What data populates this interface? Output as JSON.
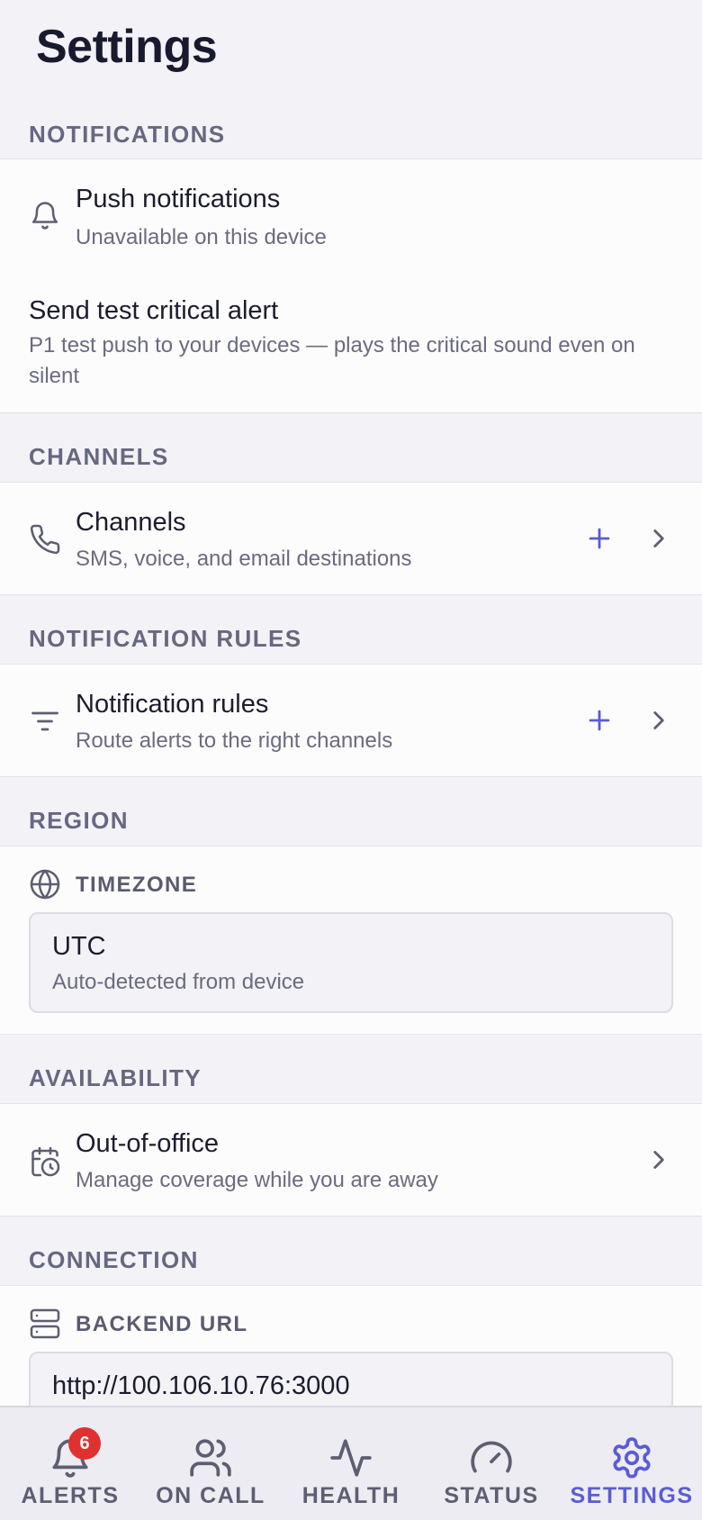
{
  "header": {
    "title": "Settings"
  },
  "sections": {
    "notifications": {
      "label": "NOTIFICATIONS",
      "push": {
        "title": "Push notifications",
        "subtitle": "Unavailable on this device",
        "icon": "bell-icon"
      },
      "test_alert": {
        "title": "Send test critical alert",
        "subtitle": "P1 test push to your devices — plays the critical sound even on silent"
      }
    },
    "channels": {
      "label": "CHANNELS",
      "row": {
        "title": "Channels",
        "subtitle": "SMS, voice, and email destinations",
        "icon": "phone-icon"
      }
    },
    "rules": {
      "label": "NOTIFICATION RULES",
      "row": {
        "title": "Notification rules",
        "subtitle": "Route alerts to the right channels",
        "icon": "filter-icon"
      }
    },
    "region": {
      "label": "REGION",
      "timezone_label": "TIMEZONE",
      "timezone_value": "UTC",
      "timezone_hint": "Auto-detected from device"
    },
    "availability": {
      "label": "AVAILABILITY",
      "row": {
        "title": "Out-of-office",
        "subtitle": "Manage coverage while you are away",
        "icon": "calendar-clock-icon"
      }
    },
    "connection": {
      "label": "CONNECTION",
      "backend_label": "BACKEND URL",
      "backend_value": "http://100.106.10.76:3000"
    }
  },
  "tabbar": {
    "tabs": [
      {
        "label": "ALERTS",
        "icon": "bell-icon",
        "badge": "6"
      },
      {
        "label": "ON CALL",
        "icon": "users-icon"
      },
      {
        "label": "HEALTH",
        "icon": "activity-icon"
      },
      {
        "label": "STATUS",
        "icon": "gauge-icon"
      },
      {
        "label": "SETTINGS",
        "icon": "gear-icon",
        "active": true
      }
    ]
  },
  "colors": {
    "accent": "#5b5bd6",
    "badge": "#e03131",
    "background": "#f2f2f7",
    "card": "#fcfcfc"
  }
}
